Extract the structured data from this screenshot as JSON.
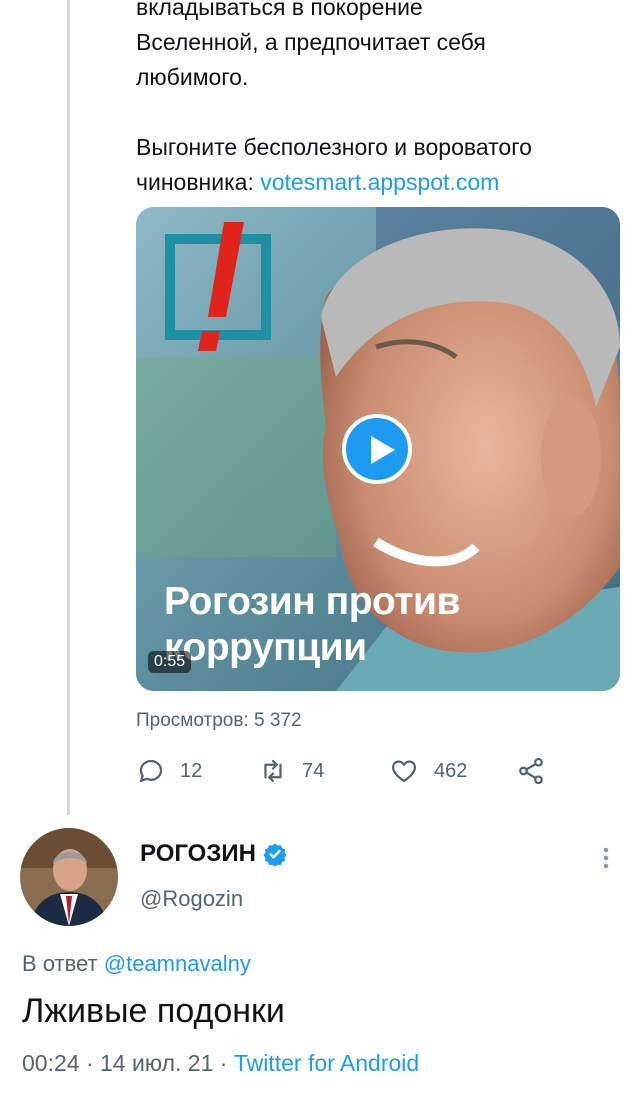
{
  "parent_tweet": {
    "text_lines": [
      "вкладываться в покорение",
      "Вселенной, а предпочитает себя",
      "любимого."
    ],
    "call_to_action": "Выгоните бесполезного и вороватого",
    "call_line2_prefix": "чиновника: ",
    "link": "votesmart.appspot.com",
    "media": {
      "title_line1": "Рогозин против",
      "title_line2": "коррупции",
      "duration": "0:55"
    },
    "views": "Просмотров: 5 372",
    "actions": {
      "replies": "12",
      "retweets": "74",
      "likes": "462"
    }
  },
  "reply_tweet": {
    "author_name": "РОГОЗИН",
    "handle": "@Rogozin",
    "reply_prefix": "В ответ ",
    "reply_to": "@teamnavalny",
    "text": "Лживые подонки",
    "time": "00:24",
    "date": "14 июл. 21",
    "source": "Twitter for Android",
    "separator": " · "
  },
  "colors": {
    "accent": "#1d9bf0",
    "muted": "#536471",
    "text": "#0f1419"
  }
}
